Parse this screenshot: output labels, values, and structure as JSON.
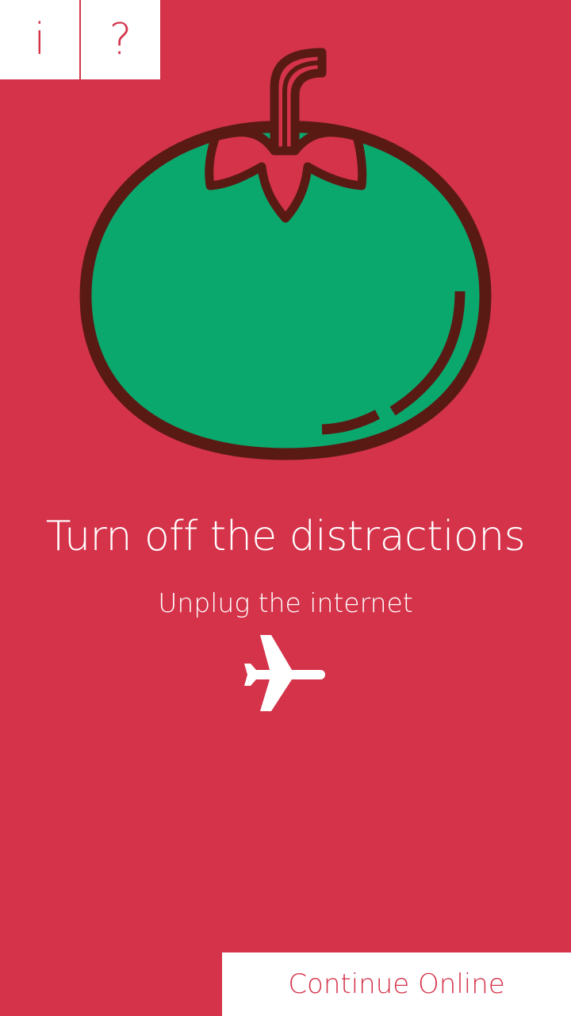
{
  "topbar": {
    "info_label": "i",
    "help_label": "?"
  },
  "illustration": {
    "icon": "tomato-icon",
    "colors": {
      "fruit": "#0ba86e",
      "outline": "#5a1a14",
      "leaves": "#d4334a"
    }
  },
  "main": {
    "headline": "Turn off the distractions",
    "subline": "Unplug the internet",
    "status_icon": "airplane-icon"
  },
  "footer": {
    "continue_label": "Continue Online"
  },
  "colors": {
    "background": "#d4334a",
    "button_background": "#ffffff",
    "text": "#ffffff",
    "button_text": "#d4334a"
  }
}
